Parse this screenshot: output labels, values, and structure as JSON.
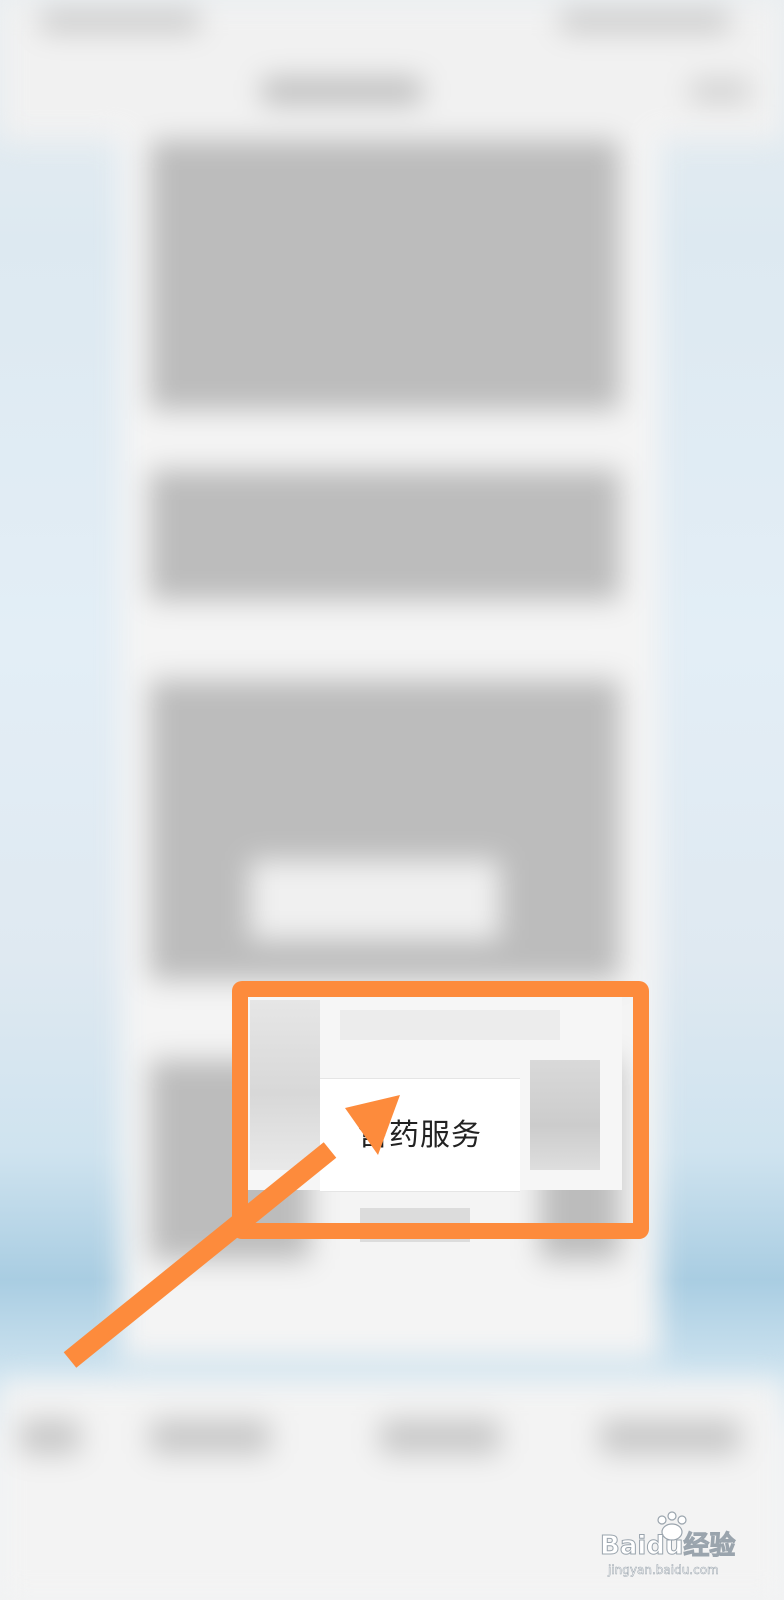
{
  "service": {
    "label": "售药服务"
  },
  "annotation": {
    "highlight_color": "#fd8b3c"
  },
  "watermark": {
    "brand": "Baidu经验",
    "url": "jingyan.baidu.com"
  }
}
